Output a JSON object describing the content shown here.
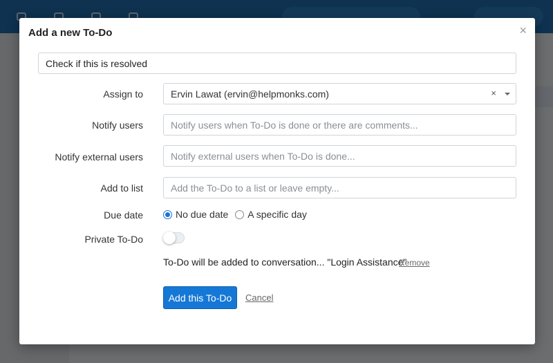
{
  "modal": {
    "title": "Add a new To-Do",
    "close_icon": "×",
    "todo_title_value": "Check if this is resolved",
    "fields": {
      "assign_to": {
        "label": "Assign to",
        "value": "Ervin Lawat (ervin@helpmonks.com)",
        "clear_icon": "×"
      },
      "notify_users": {
        "label": "Notify users",
        "placeholder": "Notify users when To-Do is done or there are comments..."
      },
      "notify_external": {
        "label": "Notify external users",
        "placeholder": "Notify external users when To-Do is done..."
      },
      "add_to_list": {
        "label": "Add to list",
        "placeholder": "Add the To-Do to a list or leave empty..."
      },
      "due_date": {
        "label": "Due date",
        "options": [
          "No due date",
          "A specific day"
        ],
        "selected": "No due date"
      },
      "private": {
        "label": "Private To-Do",
        "enabled": false
      }
    },
    "conversation_info": "To-Do will be added to conversation... \"Login Assistance\"",
    "remove_label": "Remove",
    "add_button": "Add this To-Do",
    "cancel_button": "Cancel"
  },
  "colors": {
    "primary": "#1678d6",
    "overlay": "rgba(0,0,0,0.55)"
  }
}
